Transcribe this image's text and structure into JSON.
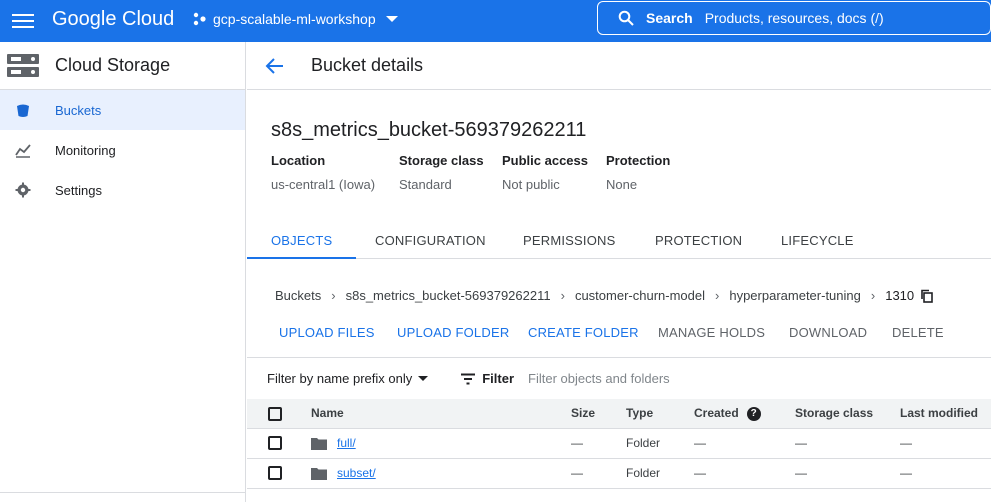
{
  "topbar": {
    "logo": "Google Cloud",
    "project": "gcp-scalable-ml-workshop",
    "search_label": "Search",
    "search_placeholder": "Products, resources, docs (/)"
  },
  "sidebar": {
    "title": "Cloud Storage",
    "items": [
      {
        "label": "Buckets",
        "icon": "bucket-icon",
        "active": true
      },
      {
        "label": "Monitoring",
        "icon": "chart-icon",
        "active": false
      },
      {
        "label": "Settings",
        "icon": "gear-icon",
        "active": false
      }
    ]
  },
  "page": {
    "title": "Bucket details",
    "bucket_name": "s8s_metrics_bucket-569379262211",
    "meta": [
      {
        "key": "Location",
        "value": "us-central1 (Iowa)"
      },
      {
        "key": "Storage class",
        "value": "Standard"
      },
      {
        "key": "Public access",
        "value": "Not public"
      },
      {
        "key": "Protection",
        "value": "None"
      }
    ]
  },
  "tabs": [
    "OBJECTS",
    "CONFIGURATION",
    "PERMISSIONS",
    "PROTECTION",
    "LIFECYCLE"
  ],
  "breadcrumb": [
    "Buckets",
    "s8s_metrics_bucket-569379262211",
    "customer-churn-model",
    "hyperparameter-tuning",
    "1310"
  ],
  "actions": {
    "upload_files": "UPLOAD FILES",
    "upload_folder": "UPLOAD FOLDER",
    "create_folder": "CREATE FOLDER",
    "manage_holds": "MANAGE HOLDS",
    "download": "DOWNLOAD",
    "delete": "DELETE"
  },
  "filter": {
    "select_label": "Filter by name prefix only",
    "filter_label": "Filter",
    "placeholder": "Filter objects and folders"
  },
  "table": {
    "headers": [
      "Name",
      "Size",
      "Type",
      "Created",
      "Storage class",
      "Last modified"
    ],
    "rows": [
      {
        "name": "full/",
        "size": "—",
        "type": "Folder",
        "created": "—",
        "storage_class": "—",
        "last_modified": "—"
      },
      {
        "name": "subset/",
        "size": "—",
        "type": "Folder",
        "created": "—",
        "storage_class": "—",
        "last_modified": "—"
      }
    ]
  },
  "colors": {
    "accent": "#1a73e8",
    "active_bg": "#e8f0fe"
  }
}
